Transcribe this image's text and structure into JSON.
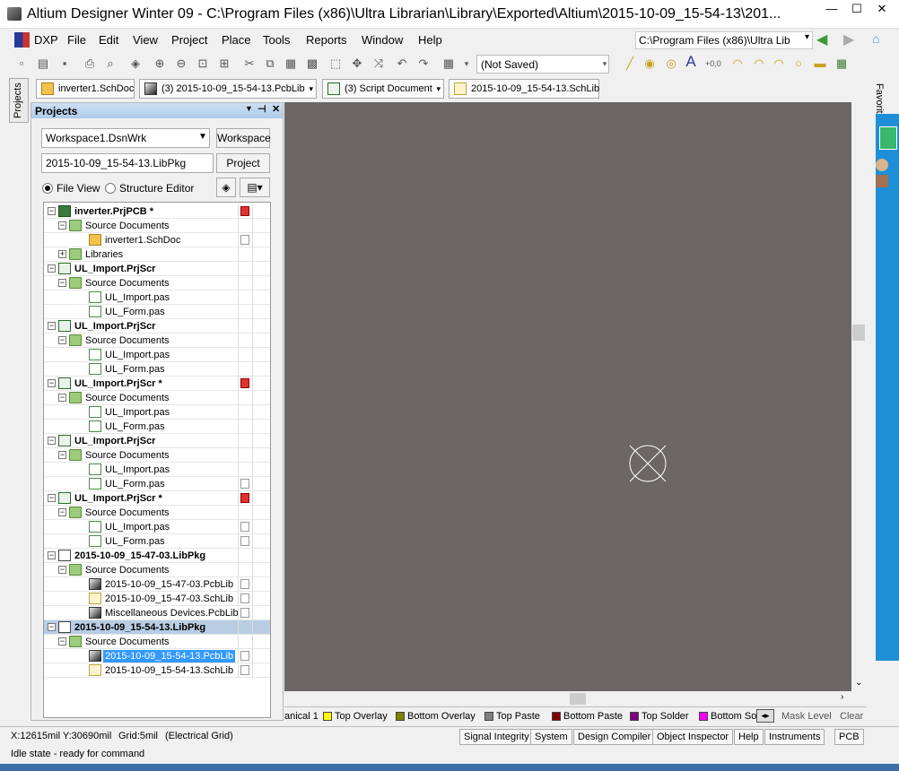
{
  "window": {
    "title": "Altium Designer Winter 09 - C:\\Program Files (x86)\\Ultra Librarian\\Library\\Exported\\Altium\\2015-10-09_15-54-13\\201...",
    "minimize": "—",
    "maximize": "☐",
    "close": "✕"
  },
  "menu": {
    "items": [
      "DXP",
      "File",
      "Edit",
      "View",
      "Project",
      "Place",
      "Tools",
      "Reports",
      "Window",
      "Help"
    ],
    "path": "C:\\Program Files (x86)\\Ultra Lib"
  },
  "toolbar": {
    "save_state": "(Not Saved)"
  },
  "doc_tabs": [
    {
      "label": "inverter1.SchDoc",
      "icon": "schematic-icon"
    },
    {
      "label": "(3) 2015-10-09_15-54-13.PcbLib",
      "icon": "pcblib-icon"
    },
    {
      "label": "(3) Script Document",
      "icon": "script-icon"
    },
    {
      "label": "2015-10-09_15-54-13.SchLib",
      "icon": "schlib-icon"
    }
  ],
  "left_strip": {
    "label": "Projects"
  },
  "right_strip": {
    "label": "Favorites"
  },
  "panel": {
    "title": "Projects",
    "workspace_value": "Workspace1.DsnWrk",
    "workspace_button": "Workspace",
    "project_value": "2015-10-09_15-54-13.LibPkg",
    "project_button": "Project",
    "view_file": "File View",
    "view_structure": "Structure Editor",
    "selected_view": "File View"
  },
  "tree": [
    {
      "label": "inverter.PrjPCB *",
      "level": 0,
      "bold": true,
      "icon": "prj",
      "expand": "−",
      "status": "red"
    },
    {
      "label": "Source Documents",
      "level": 1,
      "icon": "folder",
      "expand": "−"
    },
    {
      "label": "inverter1.SchDoc",
      "level": 2,
      "icon": "sch",
      "status": "doc"
    },
    {
      "label": "Libraries",
      "level": 1,
      "icon": "folder",
      "expand": "+"
    },
    {
      "label": "UL_Import.PrjScr",
      "level": 0,
      "bold": true,
      "icon": "scr",
      "expand": "−"
    },
    {
      "label": "Source Documents",
      "level": 1,
      "icon": "folder",
      "expand": "−"
    },
    {
      "label": "UL_Import.pas",
      "level": 2,
      "icon": "pas"
    },
    {
      "label": "UL_Form.pas",
      "level": 2,
      "icon": "pas"
    },
    {
      "label": "UL_Import.PrjScr",
      "level": 0,
      "bold": true,
      "icon": "scr",
      "expand": "−"
    },
    {
      "label": "Source Documents",
      "level": 1,
      "icon": "folder",
      "expand": "−"
    },
    {
      "label": "UL_Import.pas",
      "level": 2,
      "icon": "pas"
    },
    {
      "label": "UL_Form.pas",
      "level": 2,
      "icon": "pas"
    },
    {
      "label": "UL_Import.PrjScr *",
      "level": 0,
      "bold": true,
      "icon": "scr",
      "expand": "−",
      "status": "red"
    },
    {
      "label": "Source Documents",
      "level": 1,
      "icon": "folder",
      "expand": "−"
    },
    {
      "label": "UL_Import.pas",
      "level": 2,
      "icon": "pas"
    },
    {
      "label": "UL_Form.pas",
      "level": 2,
      "icon": "pas"
    },
    {
      "label": "UL_Import.PrjScr",
      "level": 0,
      "bold": true,
      "icon": "scr",
      "expand": "−"
    },
    {
      "label": "Source Documents",
      "level": 1,
      "icon": "folder",
      "expand": "−"
    },
    {
      "label": "UL_Import.pas",
      "level": 2,
      "icon": "pas"
    },
    {
      "label": "UL_Form.pas",
      "level": 2,
      "icon": "pas",
      "status": "doc"
    },
    {
      "label": "UL_Import.PrjScr *",
      "level": 0,
      "bold": true,
      "icon": "scr",
      "expand": "−",
      "status": "red"
    },
    {
      "label": "Source Documents",
      "level": 1,
      "icon": "folder",
      "expand": "−"
    },
    {
      "label": "UL_Import.pas",
      "level": 2,
      "icon": "pas",
      "status": "doc"
    },
    {
      "label": "UL_Form.pas",
      "level": 2,
      "icon": "pas",
      "status": "doc"
    },
    {
      "label": "2015-10-09_15-47-03.LibPkg",
      "level": 0,
      "bold": true,
      "icon": "pkg",
      "expand": "−"
    },
    {
      "label": "Source Documents",
      "level": 1,
      "icon": "folder",
      "expand": "−"
    },
    {
      "label": "2015-10-09_15-47-03.PcbLib",
      "level": 2,
      "icon": "pcblib",
      "status": "doc"
    },
    {
      "label": "2015-10-09_15-47-03.SchLib",
      "level": 2,
      "icon": "schlib",
      "status": "doc"
    },
    {
      "label": "Miscellaneous Devices.PcbLib",
      "level": 2,
      "icon": "pcblib",
      "status": "doc"
    },
    {
      "label": "2015-10-09_15-54-13.LibPkg",
      "level": 0,
      "bold": true,
      "icon": "pkg",
      "expand": "−",
      "group": true
    },
    {
      "label": "Source Documents",
      "level": 1,
      "icon": "folder",
      "expand": "−"
    },
    {
      "label": "2015-10-09_15-54-13.PcbLib",
      "level": 2,
      "icon": "pcblib",
      "status": "doc",
      "selected": true
    },
    {
      "label": "2015-10-09_15-54-13.SchLib",
      "level": 2,
      "icon": "schlib",
      "status": "doc"
    }
  ],
  "layers": [
    {
      "label": "anical 1",
      "color": ""
    },
    {
      "label": "Top Overlay",
      "color": "#ffff00"
    },
    {
      "label": "Bottom Overlay",
      "color": "#808000"
    },
    {
      "label": "Top Paste",
      "color": "#808080"
    },
    {
      "label": "Bottom Paste",
      "color": "#800000"
    },
    {
      "label": "Top Solder",
      "color": "#800080"
    },
    {
      "label": "Bottom So",
      "color": "#ff00ff"
    }
  ],
  "layer_controls": {
    "mask": "Mask Level",
    "clear": "Clear"
  },
  "status": {
    "coords": "X:12615mil Y:30690mil",
    "grid": "Grid:5mil",
    "grid_type": "(Electrical Grid)",
    "state": "Idle state - ready for command",
    "panels": [
      "Signal Integrity",
      "System",
      "Design Compiler",
      "Object Inspector",
      "Help",
      "Instruments",
      "PCB"
    ]
  },
  "colors": {
    "canvas": "#6b6766",
    "selection": "#3399ff",
    "panel_header": "#aecbea",
    "accent_blue": "#1e8fd6"
  }
}
